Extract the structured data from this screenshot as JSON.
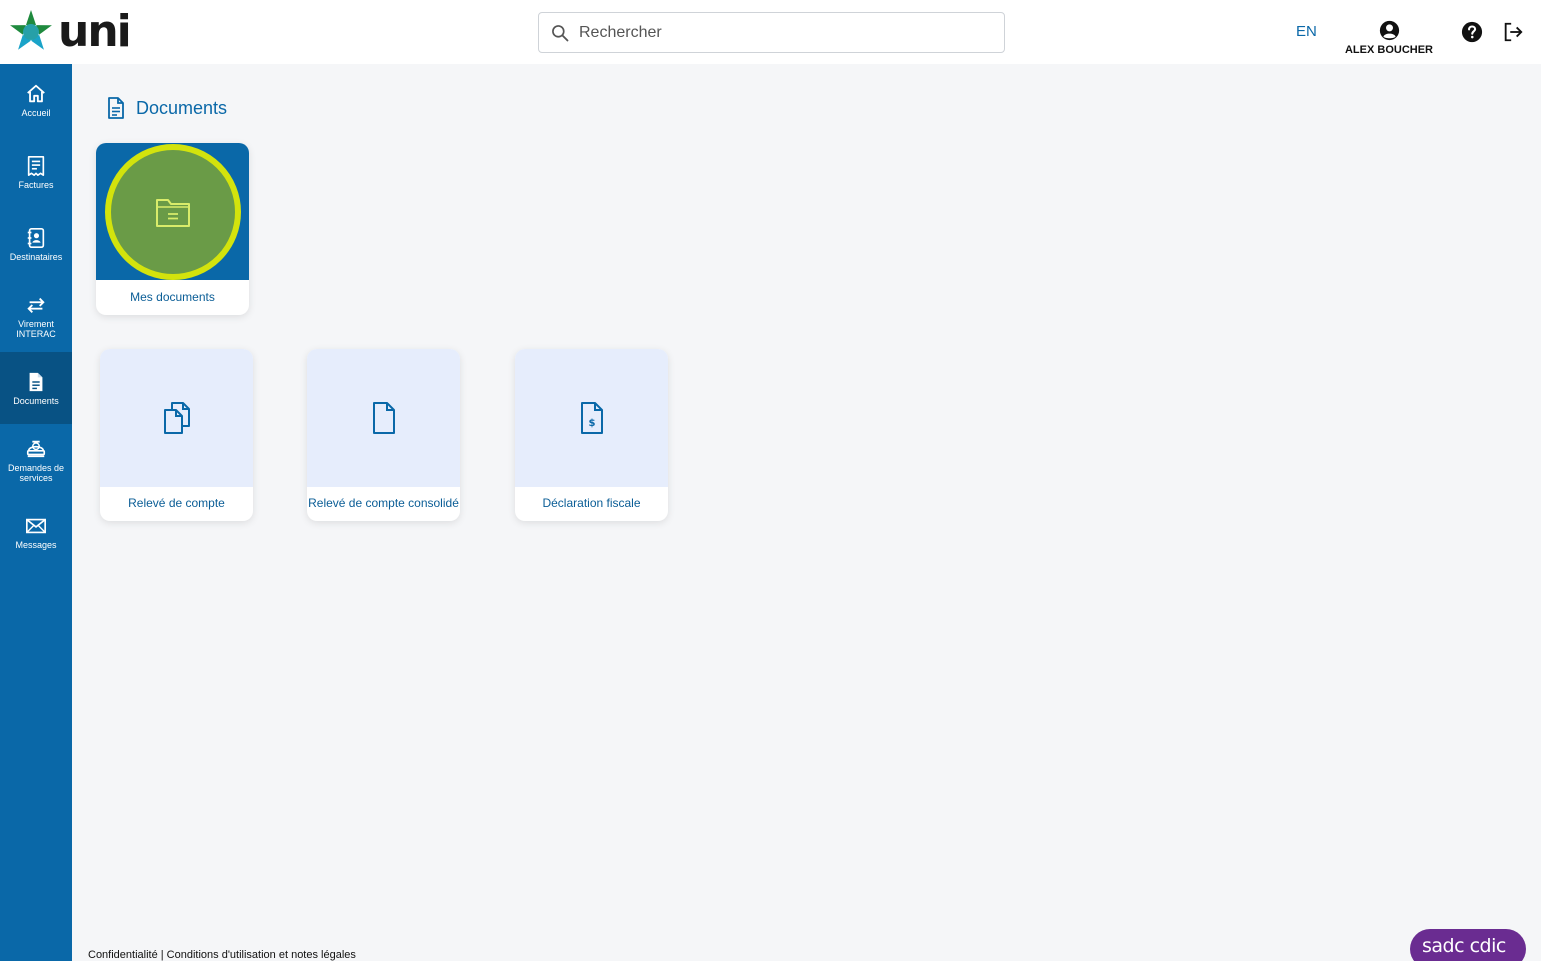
{
  "header": {
    "logo_text": "uni",
    "search_placeholder": "Rechercher",
    "language_toggle": "EN",
    "user_name": "ALEX BOUCHER"
  },
  "sidebar": {
    "items": [
      {
        "label": "Accueil",
        "icon": "home-icon"
      },
      {
        "label": "Factures",
        "icon": "receipt-icon"
      },
      {
        "label": "Destinataires",
        "icon": "contacts-icon"
      },
      {
        "label": "Virement INTERAC",
        "icon": "transfer-arrows-icon"
      },
      {
        "label": "Documents",
        "icon": "document-icon",
        "active": true
      },
      {
        "label": "Demandes de services",
        "icon": "service-request-icon"
      },
      {
        "label": "Messages",
        "icon": "envelope-icon"
      }
    ]
  },
  "main": {
    "page_title": "Documents",
    "folder_card": {
      "label": "Mes documents",
      "icon": "folder-icon"
    },
    "document_cards": [
      {
        "label": "Relevé de compte",
        "icon": "multiple-files-icon"
      },
      {
        "label": "Relevé de compte consolidé",
        "icon": "file-icon"
      },
      {
        "label": "Déclaration fiscale",
        "icon": "tax-document-icon"
      }
    ]
  },
  "footer": {
    "links": "Confidentialité | Conditions d'utilisation et notes légales",
    "cdic_badge": "sadc cdic"
  },
  "colors": {
    "primary_blue": "#0a68a8",
    "active_nav": "#085284",
    "highlight_ring": "#d3e30d",
    "highlight_fill": "#6a9b47",
    "card_tint": "#e6edfc",
    "cdic_purple": "#6a2c91"
  }
}
